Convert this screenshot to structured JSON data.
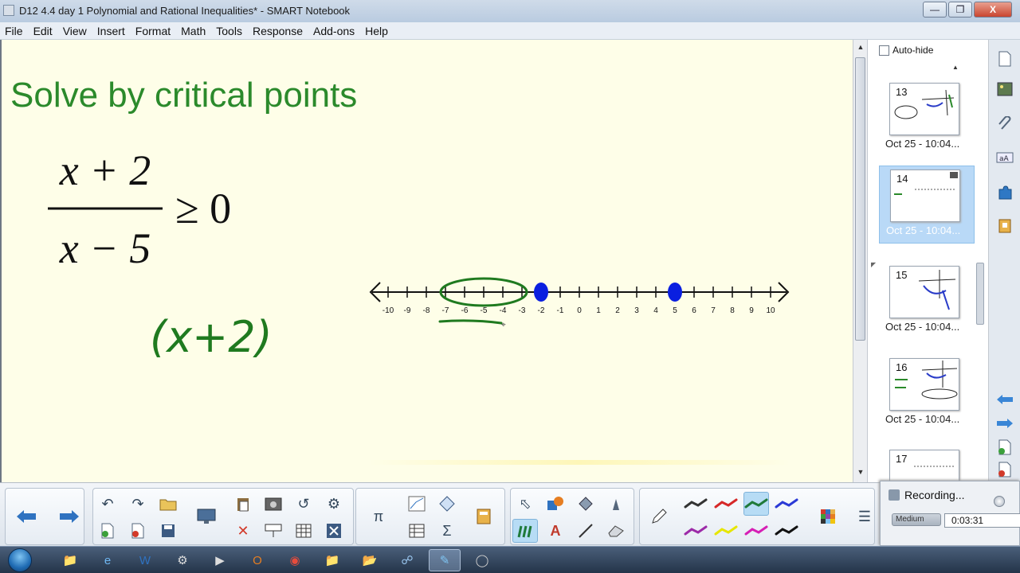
{
  "window": {
    "title": "D12  4.4 day 1 Polynomial and Rational Inequalities* - SMART Notebook",
    "minimize_glyph": "—",
    "maximize_glyph": "❐",
    "close_glyph": "X"
  },
  "menu": [
    "File",
    "Edit",
    "View",
    "Insert",
    "Format",
    "Math",
    "Tools",
    "Response",
    "Add-ons",
    "Help"
  ],
  "canvas": {
    "title": "Solve by critical points",
    "inequality": {
      "numerator": "x + 2",
      "denominator": "x − 5",
      "relation": "≥ 0"
    },
    "number_line": {
      "min": -10,
      "max": 10,
      "tick_labels": [
        "-10",
        "-9",
        "-8",
        "-7",
        "-6",
        "-5",
        "-4",
        "-3",
        "-2",
        "-1",
        "0",
        "1",
        "2",
        "3",
        "4",
        "5",
        "6",
        "7",
        "8",
        "9",
        "10"
      ],
      "points": [
        -2,
        5
      ],
      "point_color": "#0a1fe0",
      "circled_range": [
        -7,
        -3
      ],
      "ink_color": "#1f7a1f"
    },
    "handwriting": "(x+2)"
  },
  "sorter": {
    "autohide_label": "Auto-hide",
    "pages": [
      {
        "number": "13",
        "date": "Oct 25 - 10:04...",
        "selected": false
      },
      {
        "number": "14",
        "date": "Oct 25 - 10:04...",
        "selected": true
      },
      {
        "number": "15",
        "date": "Oct 25 - 10:04...",
        "selected": false
      },
      {
        "number": "16",
        "date": "Oct 25 - 10:04...",
        "selected": false
      },
      {
        "number": "17",
        "date": "",
        "selected": false
      }
    ]
  },
  "sidetabs": [
    "page-sorter-icon",
    "gallery-icon",
    "attachments-icon",
    "properties-icon",
    "addons-icon",
    "lesson-activity-icon",
    "back-arrow-icon",
    "forward-arrow-icon",
    "add-page-icon",
    "delete-page-icon"
  ],
  "toolbar": {
    "pen_colors": [
      "#333333",
      "#d62828",
      "#1f7a3a",
      "#2b3ad6",
      "#9c2aa8",
      "#e6e600",
      "#d61fb5",
      "#111111"
    ],
    "active_pen_index": 2
  },
  "recording": {
    "label": "Recording...",
    "quality": "Medium",
    "time": "0:03:31"
  },
  "taskbar": {
    "apps": [
      "explorer-icon",
      "internet-explorer-icon",
      "word-icon",
      "misc-app-icon",
      "media-icon",
      "outlook-icon",
      "chrome-icon",
      "folder-icon",
      "folder-icon-2",
      "network-icon",
      "smart-notebook-icon",
      "recorder-icon"
    ]
  }
}
